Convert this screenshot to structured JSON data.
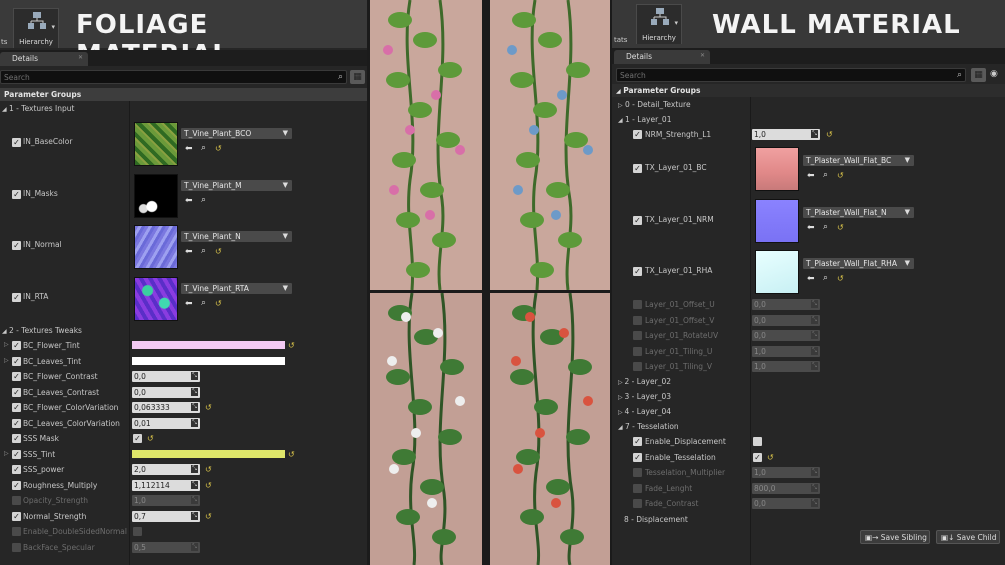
{
  "left": {
    "title": "FOLIAGE MATERIAL",
    "toolbar_stub": "ts",
    "hierarchy_label": "Hierarchy",
    "details_tab": "Details",
    "search_placeholder": "Search",
    "param_groups_header": "Parameter Groups",
    "group1": "1 - Textures Input",
    "textures": [
      {
        "label": "IN_BaseColor",
        "asset": "T_Vine_Plant_BCO"
      },
      {
        "label": "IN_Masks",
        "asset": "T_Vine_Plant_M"
      },
      {
        "label": "IN_Normal",
        "asset": "T_Vine_Plant_N"
      },
      {
        "label": "IN_RTA",
        "asset": "T_Vine_Plant_RTA"
      }
    ],
    "group2": "2 - Textures Tweaks",
    "tweaks": [
      {
        "label": "BC_Flower_Tint",
        "kind": "color",
        "color": "#f3c9f3",
        "expander": true,
        "reset": true
      },
      {
        "label": "BC_Leaves_Tint",
        "kind": "color",
        "color": "#ffffff",
        "expander": true,
        "reset": false
      },
      {
        "label": "BC_Flower_Contrast",
        "kind": "num",
        "value": "0,0",
        "reset": false
      },
      {
        "label": "BC_Leaves_Contrast",
        "kind": "num",
        "value": "0,0",
        "reset": false
      },
      {
        "label": "BC_Flower_ColorVariation",
        "kind": "num",
        "value": "0,063333",
        "reset": true
      },
      {
        "label": "BC_Leaves_ColorVariation",
        "kind": "num",
        "value": "0,01",
        "reset": false
      },
      {
        "label": "SSS Mask",
        "kind": "check",
        "reset": true
      },
      {
        "label": "SSS_Tint",
        "kind": "color",
        "color": "#dfe66a",
        "expander": true,
        "reset": true
      },
      {
        "label": "SSS_power",
        "kind": "num",
        "value": "2,0",
        "reset": true
      },
      {
        "label": "Roughness_Multiply",
        "kind": "num",
        "value": "1,112114",
        "reset": true
      },
      {
        "label": "Opacity_Strength",
        "kind": "num",
        "value": "1,0",
        "disabled": true
      },
      {
        "label": "Normal_Strength",
        "kind": "num",
        "value": "0,7",
        "reset": true
      },
      {
        "label": "Enable_DoubleSidedNormal",
        "kind": "check",
        "disabled": true
      },
      {
        "label": "BackFace_Specular",
        "kind": "num",
        "value": "0,5",
        "disabled": true
      }
    ]
  },
  "right": {
    "title": "WALL MATERIAL",
    "toolbar_stub": "tats",
    "hierarchy_label": "Hierarchy",
    "details_tab": "Details",
    "search_placeholder": "Search",
    "param_groups_header": "Parameter Groups",
    "group0": "0 - Detail_Texture",
    "group1": "1 - Layer_01",
    "nrm_strength": {
      "label": "NRM_Strength_L1",
      "value": "1,0"
    },
    "textures": [
      {
        "label": "TX_Layer_01_BC",
        "asset": "T_Plaster_Wall_Flat_BC"
      },
      {
        "label": "TX_Layer_01_NRM",
        "asset": "T_Plaster_Wall_Flat_N"
      },
      {
        "label": "TX_Layer_01_RHA",
        "asset": "T_Plaster_Wall_Flat_RHA"
      }
    ],
    "layer_params": [
      {
        "label": "Layer_01_Offset_U",
        "value": "0,0"
      },
      {
        "label": "Layer_01_Offset_V",
        "value": "0,0"
      },
      {
        "label": "Layer_01_RotateUV",
        "value": "0,0"
      },
      {
        "label": "Layer_01_Tiling_U",
        "value": "1,0"
      },
      {
        "label": "Layer_01_Tiling_V",
        "value": "1,0"
      }
    ],
    "collapsed_groups": [
      "2 - Layer_02",
      "3 - Layer_03",
      "4 - Layer_04"
    ],
    "group7": "7 - Tesselation",
    "tess": [
      {
        "label": "Enable_Displacement",
        "kind": "check",
        "enabled": true,
        "checked": false
      },
      {
        "label": "Enable_Tesselation",
        "kind": "check",
        "enabled": true,
        "checked": true,
        "reset": true
      },
      {
        "label": "Tesselation_Multiplier",
        "kind": "num",
        "value": "1,0"
      },
      {
        "label": "Fade_Lenght",
        "kind": "num",
        "value": "800,0"
      },
      {
        "label": "Fade_Contrast",
        "kind": "num",
        "value": "0,0"
      }
    ],
    "group8": "8 - Displacement",
    "save_sibling": "Save Sibling",
    "save_child": "Save Child"
  }
}
